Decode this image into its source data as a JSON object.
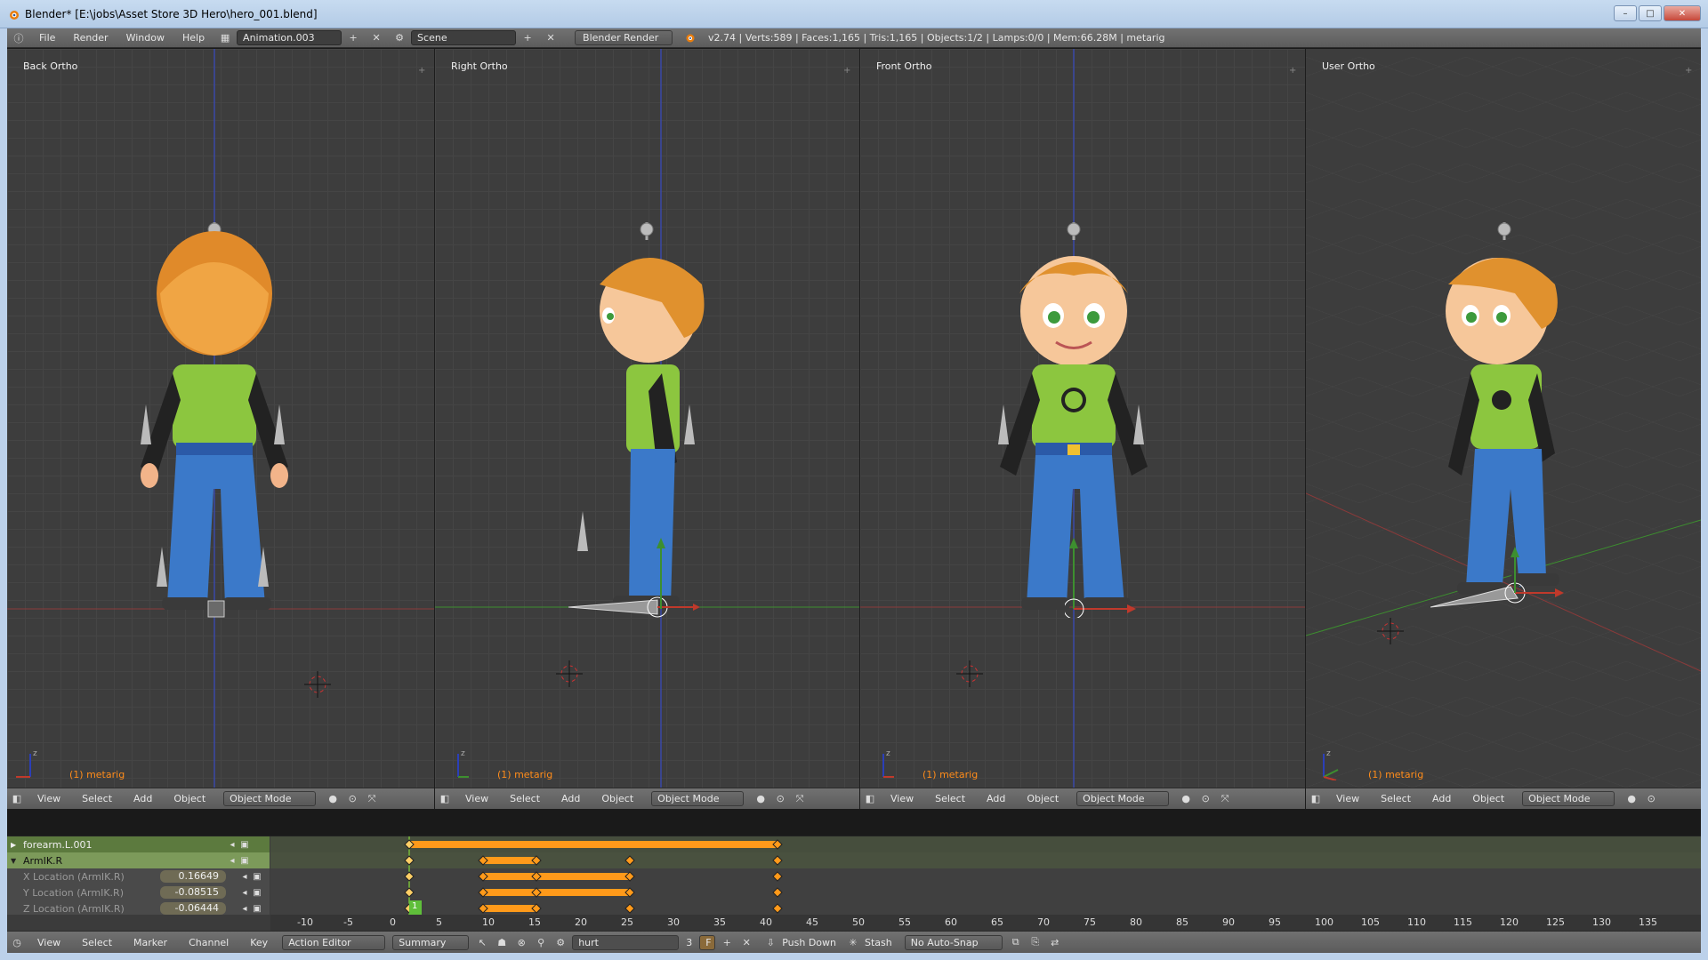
{
  "window": {
    "title": "Blender* [E:\\jobs\\Asset Store 3D Hero\\hero_001.blend]",
    "minimize": "–",
    "maximize": "□",
    "close": "✕"
  },
  "infobar": {
    "menus": [
      "File",
      "Render",
      "Window",
      "Help"
    ],
    "screen_layout": "Animation.003",
    "scene": "Scene",
    "render_engine": "Blender Render",
    "stats": "v2.74 | Verts:589 | Faces:1,165 | Tris:1,165 | Objects:1/2 | Lamps:0/0 | Mem:66.28M | metarig"
  },
  "viewports": [
    {
      "label": "Back Ortho",
      "object": "(1) metarig",
      "menus": [
        "View",
        "Select",
        "Add",
        "Object"
      ],
      "mode": "Object Mode"
    },
    {
      "label": "Right Ortho",
      "object": "(1) metarig",
      "menus": [
        "View",
        "Select",
        "Add",
        "Object"
      ],
      "mode": "Object Mode"
    },
    {
      "label": "Front Ortho",
      "object": "(1) metarig",
      "menus": [
        "View",
        "Select",
        "Add",
        "Object"
      ],
      "mode": "Object Mode"
    },
    {
      "label": "User Ortho",
      "object": "(1) metarig",
      "menus": [
        "View",
        "Select",
        "Add",
        "Object"
      ],
      "mode": "Object Mode"
    }
  ],
  "action_editor": {
    "channels": [
      {
        "name": "forearm.L.001",
        "type": "group"
      },
      {
        "name": "ArmIK.R",
        "type": "sub"
      },
      {
        "name": "X Location (ArmIK.R)",
        "value": "0.16649",
        "type": "fcurve"
      },
      {
        "name": "Y Location (ArmIK.R)",
        "value": "-0.08515",
        "type": "fcurve"
      },
      {
        "name": "Z Location (ArmIK.R)",
        "value": "-0.06444",
        "type": "fcurve"
      }
    ],
    "ruler_ticks": [
      "-10",
      "-5",
      "0",
      "5",
      "10",
      "15",
      "20",
      "25",
      "30",
      "35",
      "40",
      "45",
      "50",
      "55",
      "60",
      "65",
      "70",
      "75",
      "80",
      "85",
      "90",
      "95",
      "100",
      "105",
      "110",
      "115",
      "120",
      "125",
      "130",
      "135"
    ],
    "current_frame": "1",
    "header": {
      "menus": [
        "View",
        "Select",
        "Marker",
        "Channel",
        "Key"
      ],
      "editor_mode": "Action Editor",
      "summary": "Summary",
      "action_name": "hurt",
      "users": "3",
      "fake_user": "F",
      "push_down": "Push Down",
      "stash": "Stash",
      "auto_snap": "No Auto-Snap"
    }
  },
  "colors": {
    "keyframe": "#ff9a1a",
    "grid_bg": "#3d3d3d",
    "object_label": "#ff8c1a",
    "x_axis": "#c0392b",
    "y_axis": "#3d8f2f",
    "z_axis": "#2b3fb8"
  }
}
